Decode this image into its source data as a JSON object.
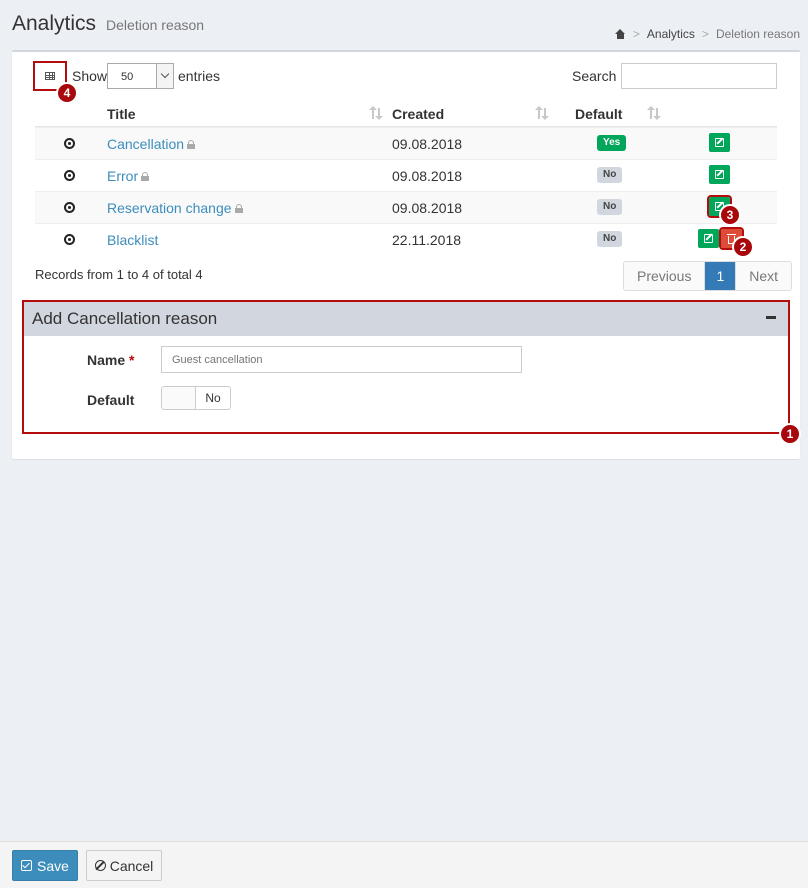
{
  "header": {
    "title": "Analytics",
    "subtitle": "Deletion reason"
  },
  "breadcrumb": {
    "home_icon": "home-icon",
    "items": [
      "Analytics",
      "Deletion reason"
    ],
    "separator": ">"
  },
  "table_controls": {
    "show_label": "Show",
    "page_length": "50",
    "entries_label": "entries",
    "search_label": "Search",
    "search_value": ""
  },
  "table": {
    "columns": [
      "Title",
      "Created",
      "Default"
    ],
    "rows": [
      {
        "title": "Cancellation",
        "locked": true,
        "created": "09.08.2018",
        "default": "Yes"
      },
      {
        "title": "Error",
        "locked": true,
        "created": "09.08.2018",
        "default": "No"
      },
      {
        "title": "Reservation change",
        "locked": true,
        "created": "09.08.2018",
        "default": "No"
      },
      {
        "title": "Blacklist",
        "locked": false,
        "created": "22.11.2018",
        "default": "No"
      }
    ]
  },
  "pagination": {
    "info": "Records from 1 to 4 of total 4",
    "previous": "Previous",
    "current": "1",
    "next": "Next"
  },
  "form_panel": {
    "title": "Add Cancellation reason",
    "name_label": "Name",
    "required_mark": "*",
    "name_placeholder": "Guest cancellation",
    "default_label": "Default",
    "default_toggle": "No"
  },
  "footer": {
    "save": "Save",
    "cancel": "Cancel"
  },
  "markers": [
    "1",
    "2",
    "3",
    "4"
  ],
  "colors": {
    "primary": "#3c8dbc",
    "success": "#00a65a",
    "danger": "#dd4b39",
    "highlight": "#b30c0c"
  }
}
